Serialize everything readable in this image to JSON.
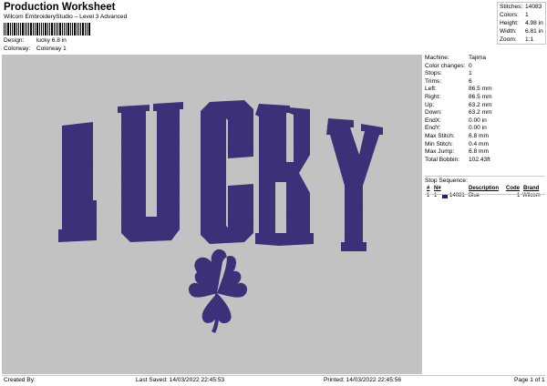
{
  "header": {
    "title": "Production Worksheet",
    "subtitle": "Wilcom EmbroideryStudio – Level 3 Advanced"
  },
  "design_info": {
    "design_label": "Design:",
    "design_value": "lucky 6.8 in",
    "colorway_label": "Colorway:",
    "colorway_value": "Colorway 1"
  },
  "summary": [
    {
      "label": "Stitches:",
      "value": "14083"
    },
    {
      "label": "Colors:",
      "value": "1"
    },
    {
      "label": "Height:",
      "value": "4.98 in"
    },
    {
      "label": "Width:",
      "value": "6.81 in"
    },
    {
      "label": "Zoom:",
      "value": "1:1"
    }
  ],
  "design": {
    "text": "LUCKY",
    "thread_color": "#3a2d73",
    "background_color": "#c2c2c2"
  },
  "params": [
    {
      "label": "Machine:",
      "value": "Tajima"
    },
    {
      "label": "Color changes:",
      "value": "0"
    },
    {
      "label": "Stops:",
      "value": "1"
    },
    {
      "label": "Trims:",
      "value": "6"
    },
    {
      "label": "Left:",
      "value": "86.5 mm"
    },
    {
      "label": "Right:",
      "value": "86.5 mm"
    },
    {
      "label": "Up:",
      "value": "63.2 mm"
    },
    {
      "label": "Down:",
      "value": "63.2 mm"
    },
    {
      "label": "EndX:",
      "value": "0.00 in"
    },
    {
      "label": "EndY:",
      "value": "0.00 in"
    },
    {
      "label": "Max Stitch:",
      "value": "6.8 mm"
    },
    {
      "label": "Min Stitch:",
      "value": "0.4 mm"
    },
    {
      "label": "Max Jump:",
      "value": "6.8 mm"
    },
    {
      "label": "Total Bobbin:",
      "value": "102.43ft"
    }
  ],
  "stop_sequence": {
    "title": "Stop Sequence:",
    "headers": [
      "#",
      "N#",
      "Description",
      "Code",
      "Brand"
    ],
    "rows": [
      {
        "num": "1",
        "n": "1",
        "stitches": "14081",
        "description": "Blue",
        "code": "1",
        "brand": "Wilcom",
        "color": "#2b1f5c"
      }
    ]
  },
  "footer": {
    "created_by": "Created By:",
    "last_saved": "Last Saved: 14/03/2022 22:45:53",
    "printed": "Printed: 14/03/2022 22:45:56",
    "page": "Page 1 of 1"
  }
}
